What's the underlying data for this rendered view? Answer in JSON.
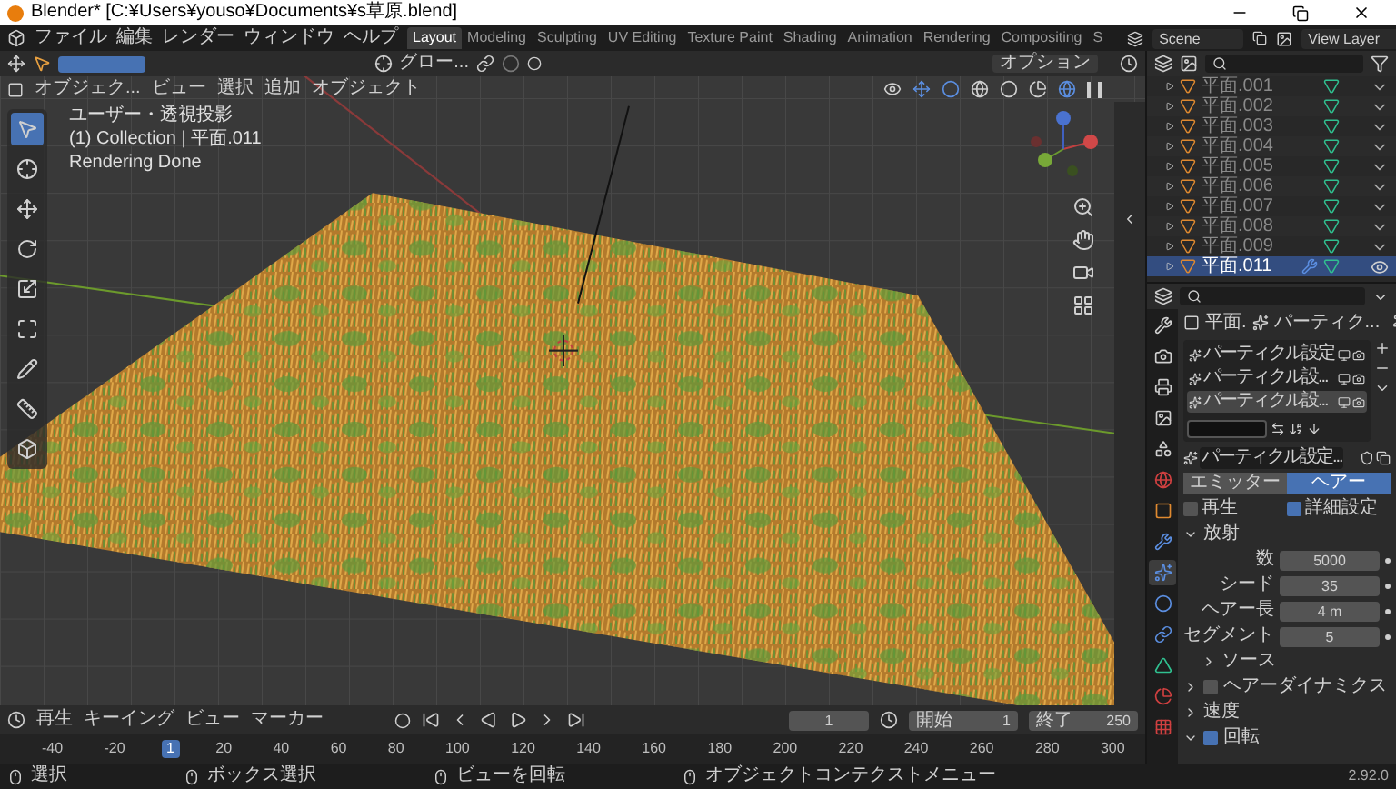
{
  "title_bar": {
    "title": "Blender* [C:¥Users¥youso¥Documents¥s草原.blend]"
  },
  "menu_bar": {
    "menus": [
      "ファイル",
      "編集",
      "レンダー",
      "ウィンドウ",
      "ヘルプ"
    ],
    "workspace_tabs": [
      {
        "label": "Layout",
        "selected": true
      },
      {
        "label": "Modeling",
        "selected": false
      },
      {
        "label": "Sculpting",
        "selected": false
      },
      {
        "label": "UV Editing",
        "selected": false
      },
      {
        "label": "Texture Paint",
        "selected": false
      },
      {
        "label": "Shading",
        "selected": false
      },
      {
        "label": "Animation",
        "selected": false
      },
      {
        "label": "Rendering",
        "selected": false
      },
      {
        "label": "Compositing",
        "selected": false
      },
      {
        "label": "S",
        "selected": false
      }
    ],
    "scene": "Scene",
    "view_layer": "View Layer"
  },
  "viewport": {
    "transform_orientation": "グロー...",
    "options": "オプション",
    "mode": "オブジェク...",
    "menus": [
      "ビュー",
      "選択",
      "追加",
      "オブジェクト"
    ],
    "overlay_lines": [
      "ユーザー・透視投影",
      "(1) Collection | 平面.011",
      "Rendering Done"
    ],
    "tools": [
      {
        "kind": "select",
        "selected": true
      },
      {
        "kind": "cursor",
        "selected": false
      },
      {
        "kind": "move",
        "selected": false
      },
      {
        "kind": "rotate",
        "selected": false
      },
      {
        "kind": "scale",
        "selected": false
      },
      {
        "kind": "transform",
        "selected": false
      },
      {
        "kind": "annotate",
        "selected": false
      },
      {
        "kind": "measure",
        "selected": false
      },
      {
        "kind": "add",
        "selected": false
      }
    ]
  },
  "outliner": {
    "rows": [
      {
        "name": "平面.001",
        "selected": false,
        "visible": false
      },
      {
        "name": "平面.002",
        "selected": false,
        "visible": false
      },
      {
        "name": "平面.003",
        "selected": false,
        "visible": false
      },
      {
        "name": "平面.004",
        "selected": false,
        "visible": false
      },
      {
        "name": "平面.005",
        "selected": false,
        "visible": false
      },
      {
        "name": "平面.006",
        "selected": false,
        "visible": false
      },
      {
        "name": "平面.007",
        "selected": false,
        "visible": false
      },
      {
        "name": "平面.008",
        "selected": false,
        "visible": false
      },
      {
        "name": "平面.009",
        "selected": false,
        "visible": false
      },
      {
        "name": "平面.011",
        "selected": true,
        "visible": true
      }
    ]
  },
  "properties": {
    "tabs": [
      {
        "kind": "tool",
        "selected": false
      },
      {
        "kind": "render",
        "selected": false
      },
      {
        "kind": "output",
        "selected": false
      },
      {
        "kind": "view_layer",
        "selected": false
      },
      {
        "kind": "scene",
        "selected": false
      },
      {
        "kind": "world",
        "selected": false
      },
      {
        "kind": "object",
        "selected": false
      },
      {
        "kind": "modifiers",
        "selected": false
      },
      {
        "kind": "particles",
        "selected": true
      },
      {
        "kind": "physics",
        "selected": false
      },
      {
        "kind": "constraints",
        "selected": false
      },
      {
        "kind": "data",
        "selected": false
      },
      {
        "kind": "material",
        "selected": false
      },
      {
        "kind": "texture",
        "selected": false
      }
    ],
    "breadcrumb": [
      "平面.",
      "パーティク..."
    ],
    "particle_systems": [
      {
        "name": "パーティクル設定",
        "selected": false
      },
      {
        "name": "パーティクル設...",
        "selected": false
      },
      {
        "name": "パーティクル設...",
        "selected": true
      }
    ],
    "settings_name": "パーティクル設定...",
    "type_toggle": [
      {
        "label": "エミッター",
        "selected": false
      },
      {
        "label": "ヘアー",
        "selected": true
      }
    ],
    "checkboxes": [
      {
        "label": "再生",
        "checked": false
      },
      {
        "label": "詳細設定",
        "checked": true
      }
    ],
    "emission": {
      "title": "放射",
      "expanded": true,
      "fields": [
        {
          "label": "数",
          "value": "5000"
        },
        {
          "label": "シード",
          "value": "35"
        },
        {
          "label": "ヘアー長",
          "value": "4 m"
        },
        {
          "label": "セグメント",
          "value": "5"
        }
      ],
      "subsection": {
        "title": "ソース",
        "expanded": false
      }
    },
    "sections": [
      {
        "title": "ヘアーダイナミクス",
        "kind": "checkbox",
        "checked": false,
        "expanded": false
      },
      {
        "title": "速度",
        "kind": "plain",
        "expanded": false
      },
      {
        "title": "回転",
        "kind": "checkbox",
        "checked": true,
        "expanded": true
      }
    ]
  },
  "timeline": {
    "menus": [
      "再生",
      "キーイング",
      "ビュー",
      "マーカー"
    ],
    "current_frame": "1",
    "start_label": "開始",
    "start": "1",
    "end_label": "終了",
    "end": "250",
    "ruler": [
      {
        "label": "-40",
        "selected": false
      },
      {
        "label": "-20",
        "selected": false
      },
      {
        "label": "1",
        "selected": true
      },
      {
        "label": "20",
        "selected": false
      },
      {
        "label": "40",
        "selected": false
      },
      {
        "label": "60",
        "selected": false
      },
      {
        "label": "80",
        "selected": false
      },
      {
        "label": "100",
        "selected": false
      },
      {
        "label": "120",
        "selected": false
      },
      {
        "label": "140",
        "selected": false
      },
      {
        "label": "160",
        "selected": false
      },
      {
        "label": "180",
        "selected": false
      },
      {
        "label": "200",
        "selected": false
      },
      {
        "label": "220",
        "selected": false
      },
      {
        "label": "240",
        "selected": false
      },
      {
        "label": "260",
        "selected": false
      },
      {
        "label": "280",
        "selected": false
      },
      {
        "label": "300",
        "selected": false
      }
    ]
  },
  "status_bar": {
    "hints": [
      "選択",
      "ボックス選択",
      "ビューを回転",
      "オブジェクトコンテクストメニュー"
    ],
    "version": "2.92.0"
  }
}
